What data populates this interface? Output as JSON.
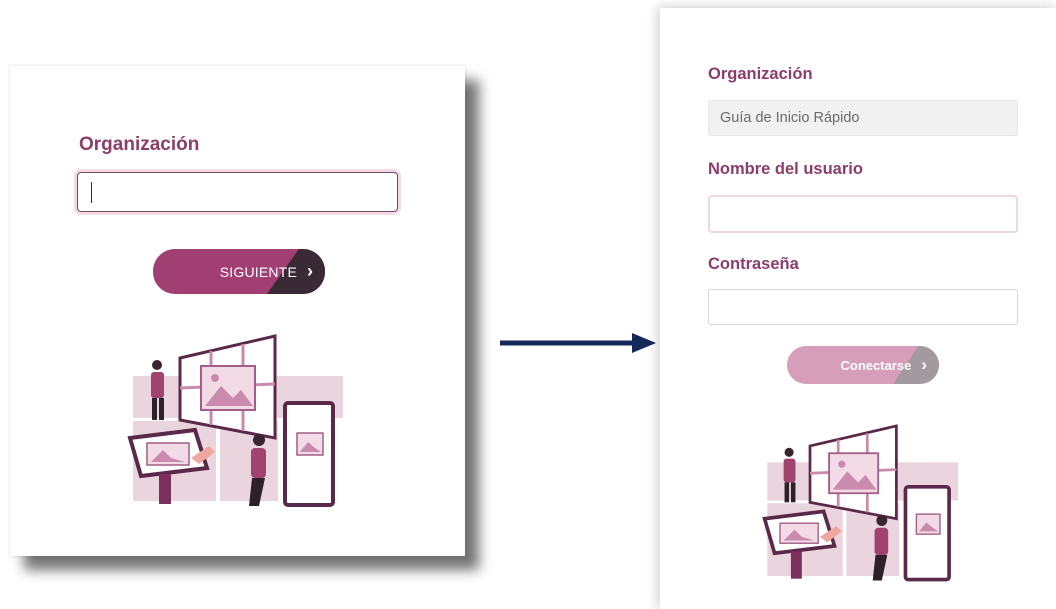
{
  "left": {
    "org_label": "Organización",
    "org_value": "",
    "next_button": "SIGUIENTE",
    "next_icon": "chevron-right-icon"
  },
  "right": {
    "org_label": "Organización",
    "org_value": "Guía de Inicio Rápido",
    "user_label": "Nombre del usuario",
    "user_value": "",
    "pass_label": "Contraseña",
    "pass_value": "",
    "login_button": "Conectarse",
    "login_icon": "chevron-right-icon"
  },
  "colors": {
    "accent": "#8e3d6a",
    "button": "#a23f72",
    "button_dark": "#3a2a35",
    "button_disabled": "#d79eb9",
    "arrow": "#14285a"
  }
}
